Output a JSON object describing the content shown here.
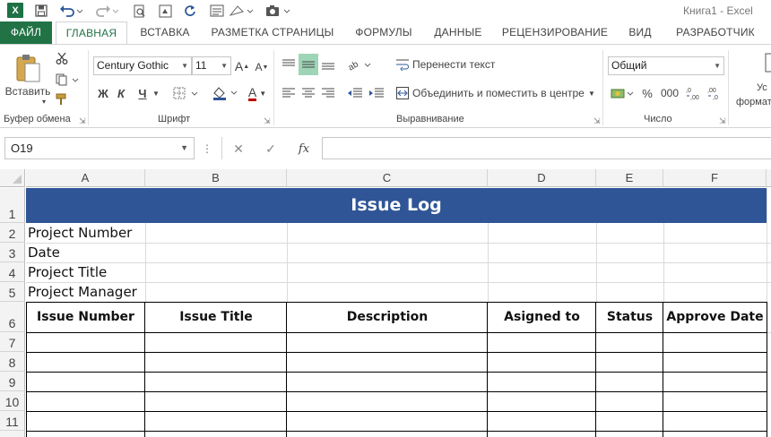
{
  "window": {
    "title": "Книга1 - Excel",
    "logo": "X"
  },
  "quick_access": {
    "icons": [
      "save-icon",
      "undo-icon",
      "redo-icon",
      "print-preview-icon",
      "file-open-icon",
      "refresh-icon",
      "form-icon",
      "shapes-icon",
      "camera-icon"
    ]
  },
  "tabs": [
    "ФАЙЛ",
    "ГЛАВНАЯ",
    "ВСТАВКА",
    "РАЗМЕТКА СТРАНИЦЫ",
    "ФОРМУЛЫ",
    "ДАННЫЕ",
    "РЕЦЕНЗИРОВАНИЕ",
    "ВИД",
    "РАЗРАБОТЧИК"
  ],
  "ribbon": {
    "clipboard": {
      "paste_label": "Вставить",
      "group_label": "Буфер обмена"
    },
    "font": {
      "font_name": "Century Gothic",
      "font_size": "11",
      "bold": "Ж",
      "italic": "К",
      "underline": "Ч",
      "grow": "A",
      "shrink": "A",
      "font_color": "A",
      "group_label": "Шрифт"
    },
    "alignment": {
      "wrap_text": "Перенести текст",
      "merge_center": "Объединить и поместить в центре",
      "group_label": "Выравнивание"
    },
    "number": {
      "format": "Общий",
      "percent": "%",
      "thousands": "000",
      "group_label": "Число"
    },
    "styles": {
      "line1": "Ус",
      "line2": "формат"
    }
  },
  "formula_bar": {
    "name_box": "O19",
    "cancel": "✕",
    "enter": "✓",
    "fx": "fx",
    "formula": ""
  },
  "sheet": {
    "columns": [
      "A",
      "B",
      "C",
      "D",
      "E",
      "F"
    ],
    "rows": [
      "1",
      "2",
      "3",
      "4",
      "5",
      "6",
      "7",
      "8",
      "9",
      "10",
      "11"
    ],
    "banner_title": "Issue Log",
    "info_labels": [
      "Project Number",
      "Date",
      "Project Title",
      "Project Manager"
    ],
    "table_headers": [
      "Issue Number",
      "Issue Title",
      "Description",
      "Asigned to",
      "Status",
      "Approve Date"
    ],
    "banner_color": "#2f5597"
  }
}
